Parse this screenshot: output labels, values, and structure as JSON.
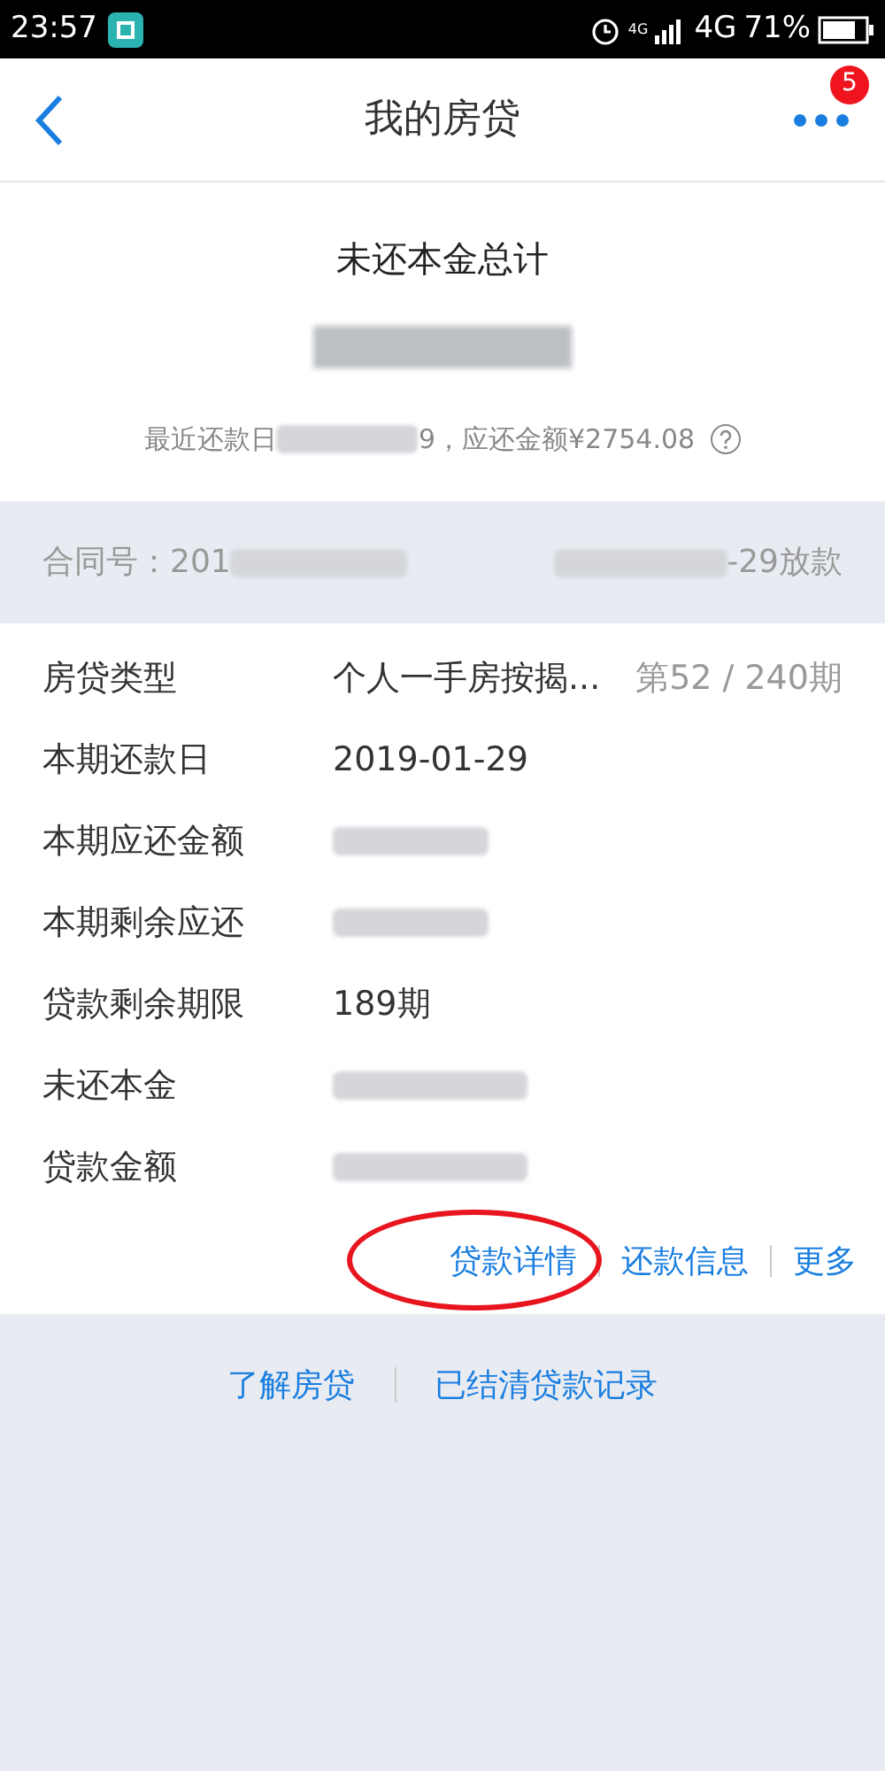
{
  "status_bar": {
    "time": "23:57",
    "network_small": "4G",
    "network": "4G",
    "battery": "71%"
  },
  "header": {
    "title": "我的房贷",
    "badge": "5"
  },
  "summary": {
    "title": "未还本金总计",
    "amount": {
      "kind": "redacted"
    },
    "note": [
      {
        "kind": "text",
        "text": "最近还款日"
      },
      {
        "kind": "redacted"
      },
      {
        "kind": "text",
        "text": "9，应还金额¥2754.08"
      }
    ]
  },
  "contract": {
    "left": [
      {
        "kind": "text",
        "text": "合同号：201"
      },
      {
        "kind": "redacted"
      }
    ],
    "right": [
      {
        "kind": "redacted"
      },
      {
        "kind": "text",
        "text": "-29放款"
      }
    ]
  },
  "details": [
    {
      "label": "房贷类型",
      "value": "个人一手房按揭...",
      "extra": "第52 / 240期",
      "redacted": false
    },
    {
      "label": "本期还款日",
      "value": "2019-01-29",
      "redacted": false
    },
    {
      "label": "本期应还金额",
      "redacted": true
    },
    {
      "label": "本期剩余应还",
      "redacted": true
    },
    {
      "label": "贷款剩余期限",
      "value": "189期",
      "redacted": false
    },
    {
      "label": "未还本金",
      "redacted": true
    },
    {
      "label": "贷款金额",
      "redacted": true
    }
  ],
  "actions": [
    {
      "label": "贷款详情",
      "circled": true
    },
    {
      "label": "还款信息",
      "circled": false
    },
    {
      "label": "更多",
      "circled": false
    }
  ],
  "footer_links": [
    "了解房贷",
    "已结清贷款记录"
  ]
}
